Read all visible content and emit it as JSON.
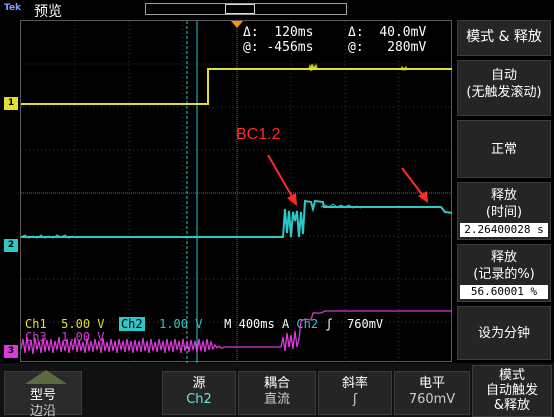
{
  "header": {
    "logo": "Tek",
    "mode_title": "预览"
  },
  "measurements": {
    "dt_label": "Δ:",
    "dt_value": "120ms",
    "dv_label": "Δ:",
    "dv_value": "40.0mV",
    "t_at_label": "@:",
    "t_at_value": "-456ms",
    "v_at_label": "@:",
    "v_at_value": "280mV"
  },
  "annotation": "BC1.2",
  "channel_markers": {
    "ch1": "1",
    "ch2": "2",
    "ch3": "3"
  },
  "channel_info": {
    "ch1_label": "Ch1",
    "ch1_scale": "5.00 V",
    "ch2_label": "Ch2",
    "ch2_scale": "1.00 V",
    "ch3_label": "Ch3",
    "ch3_scale": "1.00 V",
    "timebase": "M 400ms",
    "trigger_mode": "A",
    "trigger_source": "Ch2",
    "trigger_slope": "ʃ",
    "trigger_level": "760mV"
  },
  "side_menu": {
    "title": "模式 & 释放",
    "auto_label": "自动",
    "auto_sub": "(无触发滚动)",
    "normal_label": "正常",
    "holdoff_time_label": "释放",
    "holdoff_time_sub": "(时间)",
    "holdoff_time_value": "2.26400028 s",
    "holdoff_pct_label": "释放",
    "holdoff_pct_sub": "(记录的%)",
    "holdoff_pct_value": "56.60001 %",
    "set_min_label": "设为分钟"
  },
  "bottom_menu": {
    "type_label": "型号",
    "type_value": "边沿",
    "source_label": "源",
    "source_value": "Ch2",
    "coupling_label": "耦合",
    "coupling_value": "直流",
    "slope_label": "斜率",
    "slope_value": "ʃ",
    "level_label": "电平",
    "level_value": "760mV",
    "mode_label": "模式",
    "mode_value": "自动触发",
    "mode_value2": "&释放"
  },
  "colors": {
    "ch1": "#e1e12a",
    "ch2": "#2ec8c8",
    "ch3": "#d93ad9",
    "trigger": "#ff8c1a",
    "annotation": "#ff2a2a"
  }
}
